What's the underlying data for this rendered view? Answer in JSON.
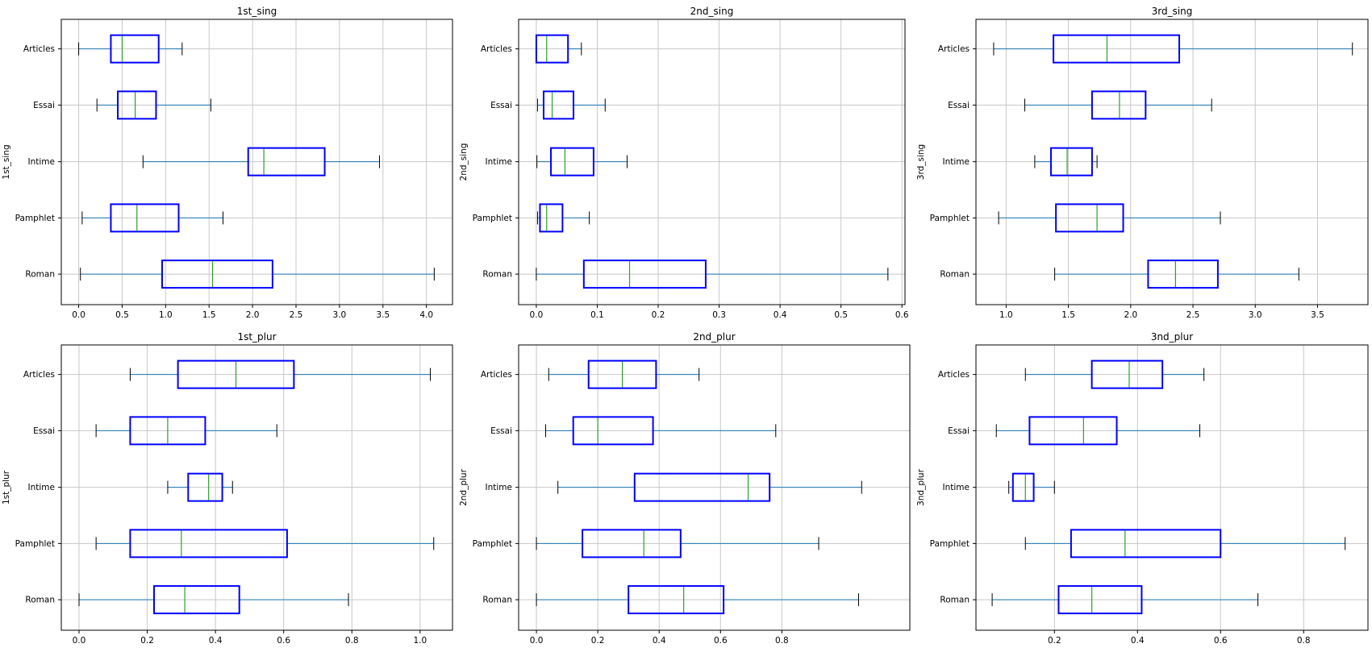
{
  "chart_data": [
    {
      "type": "boxplot",
      "title": "1st_sing",
      "ylabel": "1st_sing",
      "xlabel": "",
      "categories": [
        "Articles",
        "Essai",
        "Intime",
        "Pamphlet",
        "Roman"
      ],
      "xlim": [
        -0.2,
        4.3
      ],
      "xticks": [
        0.0,
        0.5,
        1.0,
        1.5,
        2.0,
        2.5,
        3.0,
        3.5,
        4.0
      ],
      "xtick_labels": [
        "0.0",
        "0.5",
        "1.0",
        "1.5",
        "2.0",
        "2.5",
        "3.0",
        "3.5",
        "4.0"
      ],
      "grid": true,
      "boxes": [
        {
          "whisker_low": 0.0,
          "q1": 0.37,
          "median": 0.5,
          "q3": 0.92,
          "whisker_high": 1.19
        },
        {
          "whisker_low": 0.21,
          "q1": 0.45,
          "median": 0.65,
          "q3": 0.89,
          "whisker_high": 1.52
        },
        {
          "whisker_low": 0.74,
          "q1": 1.95,
          "median": 2.13,
          "q3": 2.83,
          "whisker_high": 3.46
        },
        {
          "whisker_low": 0.04,
          "q1": 0.37,
          "median": 0.67,
          "q3": 1.15,
          "whisker_high": 1.66
        },
        {
          "whisker_low": 0.02,
          "q1": 0.96,
          "median": 1.54,
          "q3": 2.23,
          "whisker_high": 4.09
        }
      ]
    },
    {
      "type": "boxplot",
      "title": "2nd_sing",
      "ylabel": "2nd_sing",
      "xlabel": "",
      "categories": [
        "Articles",
        "Essai",
        "Intime",
        "Pamphlet",
        "Roman"
      ],
      "xlim": [
        -0.029,
        0.605
      ],
      "xticks": [
        0.0,
        0.1,
        0.2,
        0.3,
        0.4,
        0.5,
        0.6
      ],
      "xtick_labels": [
        "0.0",
        "0.1",
        "0.2",
        "0.3",
        "0.4",
        "0.5",
        "0.6"
      ],
      "grid": true,
      "boxes": [
        {
          "whisker_low": 0.0,
          "q1": 0.0,
          "median": 0.017,
          "q3": 0.052,
          "whisker_high": 0.074
        },
        {
          "whisker_low": 0.002,
          "q1": 0.012,
          "median": 0.026,
          "q3": 0.061,
          "whisker_high": 0.113
        },
        {
          "whisker_low": 0.001,
          "q1": 0.024,
          "median": 0.047,
          "q3": 0.094,
          "whisker_high": 0.149
        },
        {
          "whisker_low": 0.002,
          "q1": 0.006,
          "median": 0.017,
          "q3": 0.043,
          "whisker_high": 0.087
        },
        {
          "whisker_low": 0.0,
          "q1": 0.078,
          "median": 0.153,
          "q3": 0.278,
          "whisker_high": 0.577
        }
      ]
    },
    {
      "type": "boxplot",
      "title": "3rd_sing",
      "ylabel": "3rd_sing",
      "xlabel": "",
      "categories": [
        "Articles",
        "Essai",
        "Intime",
        "Pamphlet",
        "Roman"
      ],
      "xlim": [
        0.758,
        3.905
      ],
      "xticks": [
        1.0,
        1.5,
        2.0,
        2.5,
        3.0,
        3.5
      ],
      "xtick_labels": [
        "1.0",
        "1.5",
        "2.0",
        "2.5",
        "3.0",
        "3.5"
      ],
      "grid": true,
      "boxes": [
        {
          "whisker_low": 0.9,
          "q1": 1.38,
          "median": 1.81,
          "q3": 2.39,
          "whisker_high": 3.78
        },
        {
          "whisker_low": 1.15,
          "q1": 1.69,
          "median": 1.91,
          "q3": 2.12,
          "whisker_high": 2.65
        },
        {
          "whisker_low": 1.23,
          "q1": 1.36,
          "median": 1.49,
          "q3": 1.69,
          "whisker_high": 1.73
        },
        {
          "whisker_low": 0.94,
          "q1": 1.4,
          "median": 1.73,
          "q3": 1.94,
          "whisker_high": 2.72
        },
        {
          "whisker_low": 1.39,
          "q1": 2.14,
          "median": 2.36,
          "q3": 2.7,
          "whisker_high": 3.35
        }
      ]
    },
    {
      "type": "boxplot",
      "title": "1st_plur",
      "ylabel": "1st_plur",
      "xlabel": "",
      "categories": [
        "Articles",
        "Essai",
        "Intime",
        "Pamphlet",
        "Roman"
      ],
      "xlim": [
        -0.052,
        1.095
      ],
      "xticks": [
        0.0,
        0.2,
        0.4,
        0.6,
        0.8,
        1.0
      ],
      "xtick_labels": [
        "0.0",
        "0.2",
        "0.4",
        "0.6",
        "0.8",
        "1.0"
      ],
      "grid": true,
      "boxes": [
        {
          "whisker_low": 0.15,
          "q1": 0.29,
          "median": 0.46,
          "q3": 0.63,
          "whisker_high": 1.03
        },
        {
          "whisker_low": 0.05,
          "q1": 0.15,
          "median": 0.26,
          "q3": 0.37,
          "whisker_high": 0.58
        },
        {
          "whisker_low": 0.26,
          "q1": 0.32,
          "median": 0.38,
          "q3": 0.42,
          "whisker_high": 0.45
        },
        {
          "whisker_low": 0.05,
          "q1": 0.15,
          "median": 0.3,
          "q3": 0.61,
          "whisker_high": 1.04
        },
        {
          "whisker_low": 0.0,
          "q1": 0.22,
          "median": 0.31,
          "q3": 0.47,
          "whisker_high": 0.79
        }
      ]
    },
    {
      "type": "boxplot",
      "title": "2nd_plur",
      "ylabel": "2nd_plur",
      "xlabel": "",
      "categories": [
        "Articles",
        "Essai",
        "Intime",
        "Pamphlet",
        "Roman"
      ],
      "xlim": [
        -0.058,
        1.217
      ],
      "xticks": [
        0.0,
        0.2,
        0.4,
        0.6,
        0.8
      ],
      "xtick_labels": [
        "0.0",
        "0.2",
        "0.4",
        "0.6",
        "0.8"
      ],
      "grid": true,
      "boxes": [
        {
          "whisker_low": 0.04,
          "q1": 0.17,
          "median": 0.28,
          "q3": 0.39,
          "whisker_high": 0.53
        },
        {
          "whisker_low": 0.03,
          "q1": 0.12,
          "median": 0.2,
          "q3": 0.38,
          "whisker_high": 0.78
        },
        {
          "whisker_low": 0.07,
          "q1": 0.32,
          "median": 0.69,
          "q3": 0.76,
          "whisker_high": 1.06
        },
        {
          "whisker_low": 0.0,
          "q1": 0.15,
          "median": 0.35,
          "q3": 0.47,
          "whisker_high": 0.92
        },
        {
          "whisker_low": 0.0,
          "q1": 0.3,
          "median": 0.48,
          "q3": 0.61,
          "whisker_high": 1.05
        }
      ]
    },
    {
      "type": "boxplot",
      "title": "3nd_plur",
      "ylabel": "3nd_plur",
      "xlabel": "",
      "categories": [
        "Articles",
        "Essai",
        "Intime",
        "Pamphlet",
        "Roman"
      ],
      "xlim": [
        0.011,
        0.955
      ],
      "xticks": [
        0.2,
        0.4,
        0.6,
        0.8
      ],
      "xtick_labels": [
        "0.2",
        "0.4",
        "0.6",
        "0.8"
      ],
      "grid": true,
      "boxes": [
        {
          "whisker_low": 0.13,
          "q1": 0.29,
          "median": 0.38,
          "q3": 0.46,
          "whisker_high": 0.56
        },
        {
          "whisker_low": 0.06,
          "q1": 0.14,
          "median": 0.27,
          "q3": 0.35,
          "whisker_high": 0.55
        },
        {
          "whisker_low": 0.09,
          "q1": 0.1,
          "median": 0.13,
          "q3": 0.15,
          "whisker_high": 0.2
        },
        {
          "whisker_low": 0.13,
          "q1": 0.24,
          "median": 0.37,
          "q3": 0.6,
          "whisker_high": 0.9
        },
        {
          "whisker_low": 0.05,
          "q1": 0.21,
          "median": 0.29,
          "q3": 0.41,
          "whisker_high": 0.69
        }
      ]
    }
  ],
  "colors": {
    "box": "#0000ff",
    "whisker": "#1f77b4",
    "cap": "#000000",
    "median": "#2ca02c",
    "grid": "#c8c8c8",
    "axes": "#000000"
  }
}
